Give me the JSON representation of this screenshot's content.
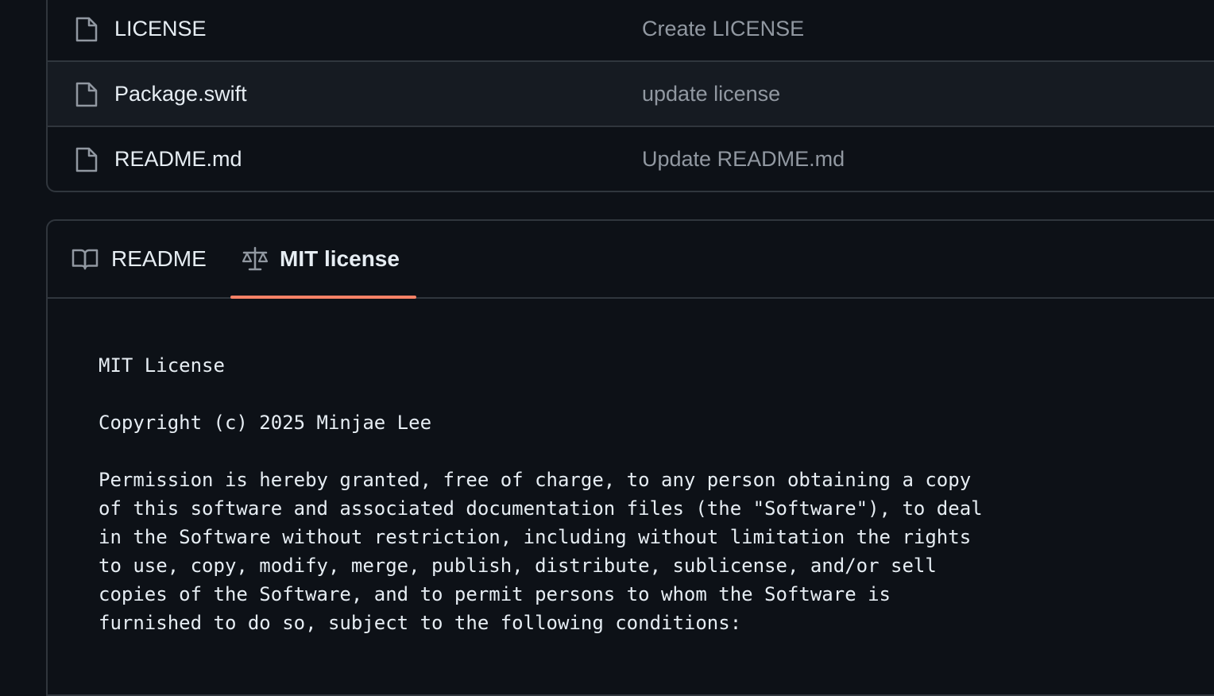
{
  "files": [
    {
      "name": "LICENSE",
      "commit_message": "Create LICENSE",
      "icon": "file-icon"
    },
    {
      "name": "Package.swift",
      "commit_message": "update license",
      "icon": "file-icon"
    },
    {
      "name": "README.md",
      "commit_message": "Update README.md",
      "icon": "file-icon"
    }
  ],
  "tabs": [
    {
      "label": "README",
      "icon": "book-icon",
      "selected": false
    },
    {
      "label": "MIT license",
      "icon": "law-scale-icon",
      "selected": true
    }
  ],
  "license": {
    "title": "MIT License",
    "copyright": "Copyright (c) 2025 Minjae Lee",
    "lines": [
      "Permission is hereby granted, free of charge, to any person obtaining a copy",
      "of this software and associated documentation files (the \"Software\"), to deal",
      "in the Software without restriction, including without limitation the rights",
      "to use, copy, modify, merge, publish, distribute, sublicense, and/or sell",
      "copies of the Software, and to permit persons to whom the Software is",
      "furnished to do so, subject to the following conditions:"
    ]
  },
  "colors": {
    "background": "#0d1117",
    "border": "#30363d",
    "row_hover": "#161b22",
    "text_primary": "#e6edf3",
    "text_muted": "#9198a1",
    "tab_underline": "#f78166"
  }
}
